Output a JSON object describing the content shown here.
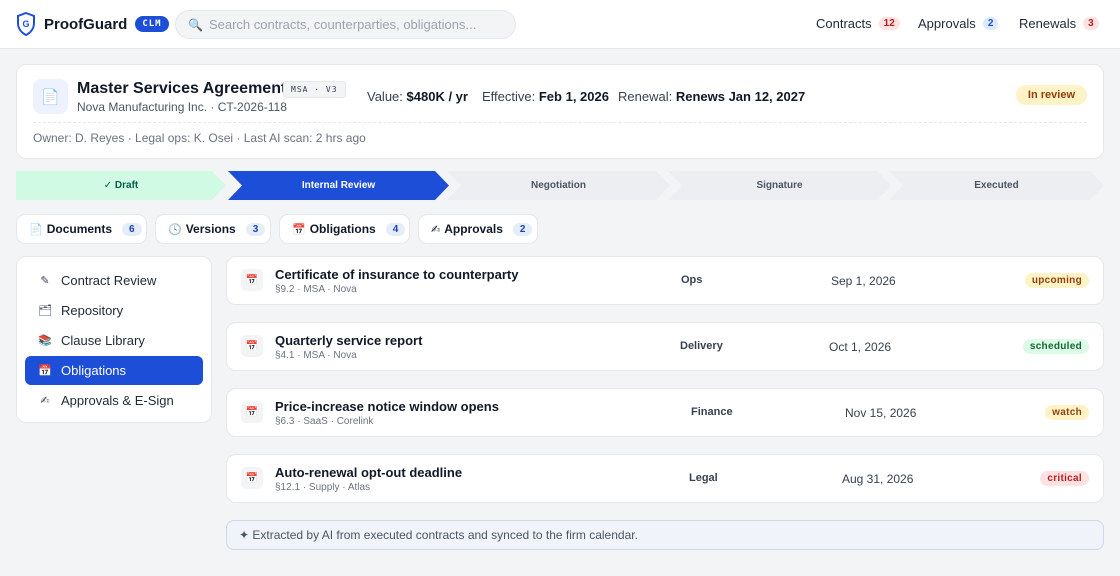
{
  "app": {
    "name": "ProofGuard",
    "badge": "CLM"
  },
  "search": {
    "placeholder": "Search contracts, counterparties, obligations..."
  },
  "nav": [
    {
      "label": "Contracts",
      "count": "12"
    },
    {
      "label": "Approvals",
      "count": "2"
    },
    {
      "label": "Renewals",
      "count": "3"
    }
  ],
  "contract": {
    "title": "Master Services Agreement",
    "tag": "MSA · V3",
    "subtitle": "Nova Manufacturing Inc. · CT-2026-118",
    "value_label": "Value:",
    "value": "$480K / yr",
    "effective_label": "Effective:",
    "effective": "Feb 1, 2026",
    "renewal_label": "Renewal:",
    "renewal": "Renews Jan 12, 2027",
    "status": "In review",
    "owner_line": "Owner: D. Reyes · Legal ops: K. Osei · Last AI scan: 2 hrs ago"
  },
  "stages": [
    {
      "label": "✓ Draft",
      "state": "done"
    },
    {
      "label": "Internal Review",
      "state": "active"
    },
    {
      "label": "Negotiation",
      "state": "todo"
    },
    {
      "label": "Signature",
      "state": "todo"
    },
    {
      "label": "Executed",
      "state": "todo"
    }
  ],
  "tabs": [
    {
      "label": "Documents",
      "count": "6",
      "icon": "document-icon"
    },
    {
      "label": "Versions",
      "count": "3",
      "icon": "clock-icon"
    },
    {
      "label": "Obligations",
      "count": "4",
      "icon": "calendar-icon"
    },
    {
      "label": "Approvals",
      "count": "2",
      "icon": "signature-icon"
    }
  ],
  "sidebar": {
    "items": [
      {
        "label": "Contract Review",
        "icon": "pen-icon"
      },
      {
        "label": "Repository",
        "icon": "folder-icon"
      },
      {
        "label": "Clause Library",
        "icon": "books-icon"
      },
      {
        "label": "Obligations",
        "icon": "calendar-icon",
        "active": true
      },
      {
        "label": "Approvals & E-Sign",
        "icon": "signature-icon"
      }
    ]
  },
  "obligations": [
    {
      "title": "Certificate of insurance to counterparty",
      "ref": "§9.2 · MSA · Nova",
      "owner": "Ops",
      "date": "Sep 1, 2026",
      "status": "upcoming"
    },
    {
      "title": "Quarterly service report",
      "ref": "§4.1 · MSA · Nova",
      "owner": "Delivery",
      "date": "Oct 1, 2026",
      "status": "scheduled"
    },
    {
      "title": "Price-increase notice window opens",
      "ref": "§6.3 · SaaS · Corelink",
      "owner": "Finance",
      "date": "Nov 15, 2026",
      "status": "watch"
    },
    {
      "title": "Auto-renewal opt-out deadline",
      "ref": "§12.1 · Supply · Atlas",
      "owner": "Legal",
      "date": "Aug 31, 2026",
      "status": "critical"
    }
  ],
  "footnote": "✦ Extracted by AI from executed contracts and synced to the firm calendar."
}
